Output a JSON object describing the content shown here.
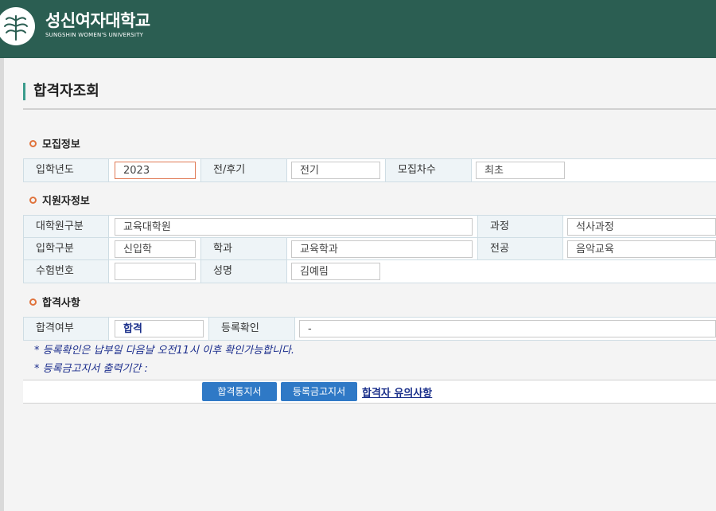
{
  "header": {
    "title_ko": "성신여자대학교",
    "title_en": "SUNGSHIN WOMEN'S UNIVERSITY"
  },
  "page_title": "합격자조회",
  "recruit_section": {
    "title": "모집정보",
    "fields": {
      "year_label": "입학년도",
      "year_value": "2023",
      "term_label": "전/후기",
      "term_value": "전기",
      "round_label": "모집차수",
      "round_value": "최초"
    }
  },
  "applicant_section": {
    "title": "지원자정보",
    "fields": {
      "grad_label": "대학원구분",
      "grad_value": "교육대학원",
      "course_label": "과정",
      "course_value": "석사과정",
      "admit_label": "입학구분",
      "admit_value": "신입학",
      "dept_label": "학과",
      "dept_value": "교육학과",
      "major_label": "전공",
      "major_value": "음악교육",
      "exam_label": "수험번호",
      "exam_value": "",
      "name_label": "성명",
      "name_value": "김예림"
    }
  },
  "result_section": {
    "title": "합격사항",
    "fields": {
      "pass_label": "합격여부",
      "pass_value": "합격",
      "reg_label": "등록확인",
      "reg_value": "-"
    },
    "notes": [
      "* 등록확인은 납부일 다음날 오전11시 이후 확인가능합니다.",
      "* 등록금고지서 출력기간 :"
    ]
  },
  "actions": {
    "pass_letter": "합격통지서",
    "tuition_bill": "등록금고지서",
    "notice_link": "합격자 유의사항"
  },
  "colors": {
    "header_bg": "#2b5e52",
    "accent": "#3a9c8c",
    "bullet": "#e0733c",
    "button": "#2f79c6"
  }
}
